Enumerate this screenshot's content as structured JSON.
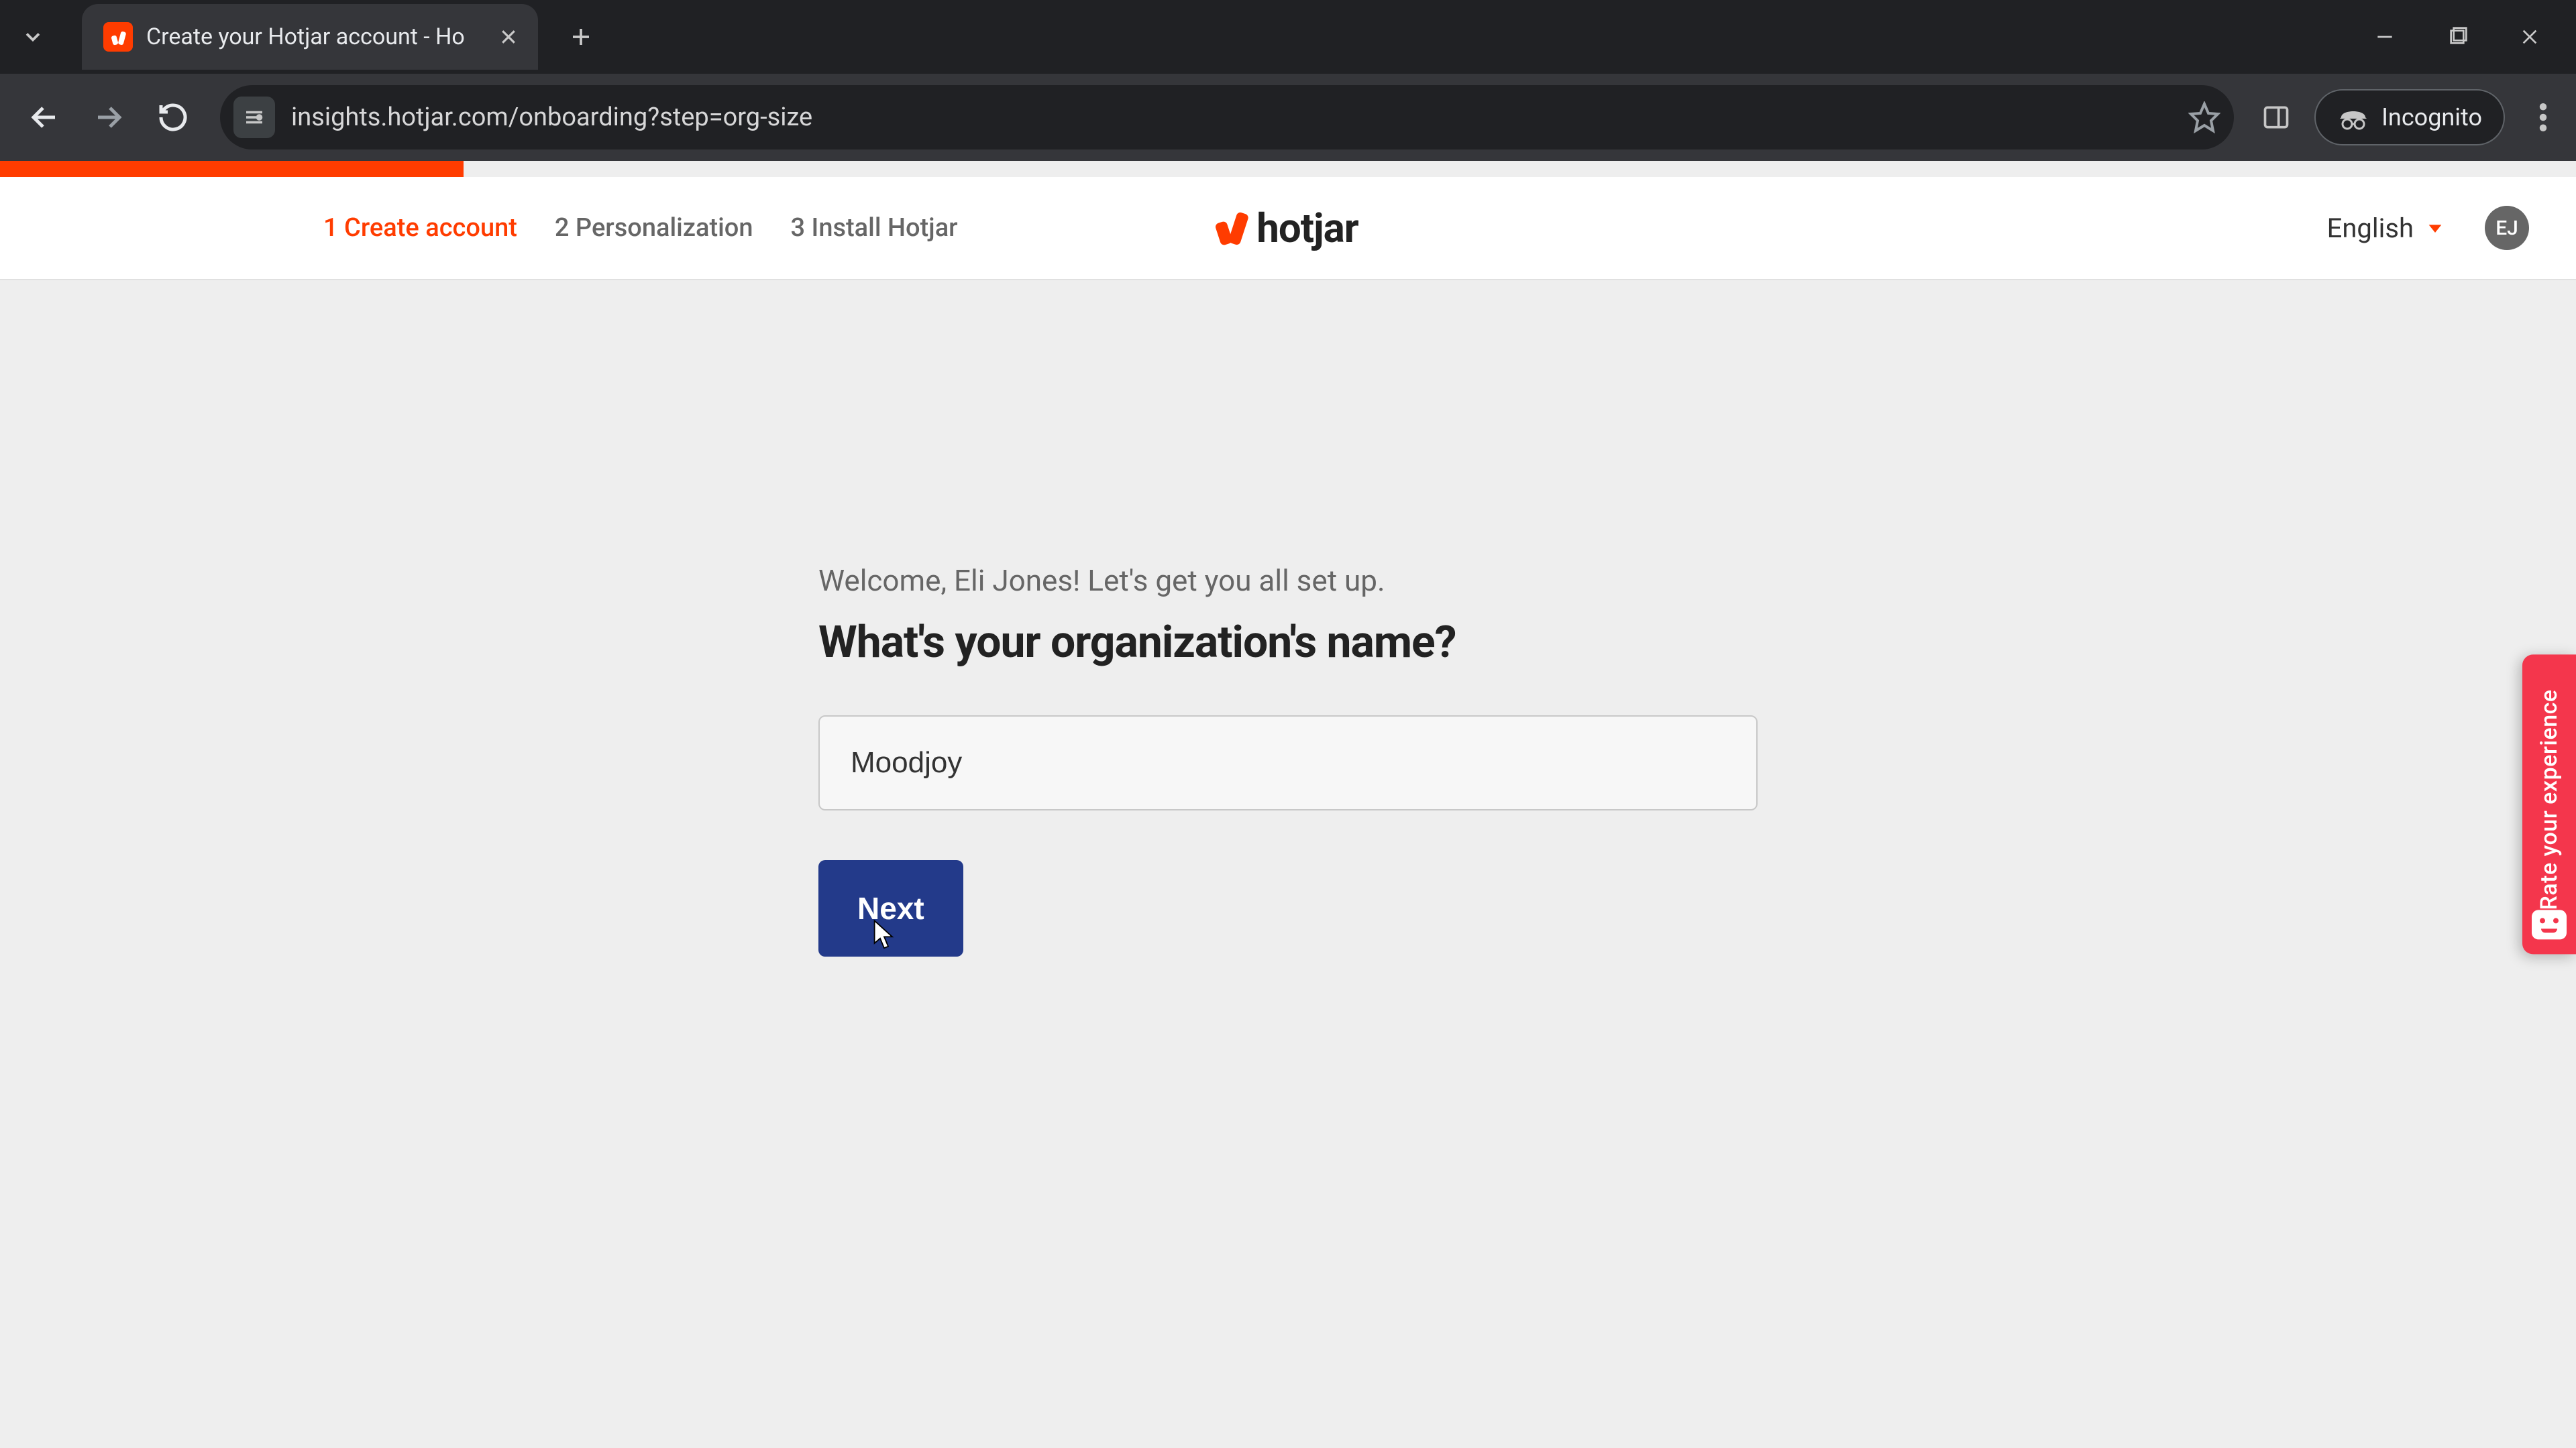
{
  "browser": {
    "tab_title": "Create your Hotjar account - Ho",
    "url": "insights.hotjar.com/onboarding?step=org-size",
    "incognito_label": "Incognito",
    "site_chip": "☰"
  },
  "topbar": {
    "steps": [
      {
        "label": "1 Create account",
        "active": true
      },
      {
        "label": "2 Personalization",
        "active": false
      },
      {
        "label": "3 Install Hotjar",
        "active": false
      }
    ],
    "brand_word": "hotjar",
    "language": "English",
    "avatar_initials": "EJ"
  },
  "content": {
    "welcome": "Welcome, Eli Jones! Let's get you all set up.",
    "heading": "What's your organization's name?",
    "org_value": "Moodjoy",
    "next_label": "Next"
  },
  "feedback": {
    "label": "Rate your experience"
  },
  "progress": {
    "percent": 18
  }
}
